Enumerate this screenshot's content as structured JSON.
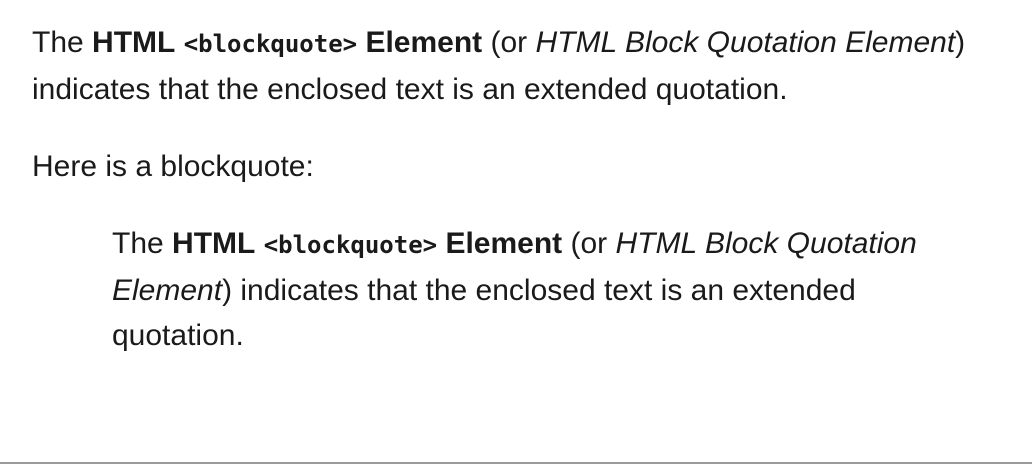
{
  "intro": {
    "the": "The",
    "html_strong": "HTML",
    "tag_code": "<blockquote>",
    "element_strong": "Element",
    "or_open": "(or",
    "alt_name_em": "HTML Block Quotation Element",
    "rest": ") indicates that the enclosed text is an extended quotation."
  },
  "lead_text": "Here is a blockquote:",
  "blockquote": {
    "the": "The",
    "html_strong": "HTML",
    "tag_code": "<blockquote>",
    "element_strong": "Element",
    "or_open": "(or",
    "alt_name_em": "HTML Block Quotation Element",
    "rest": ") indicates that the enclosed text is an extended quotation."
  }
}
